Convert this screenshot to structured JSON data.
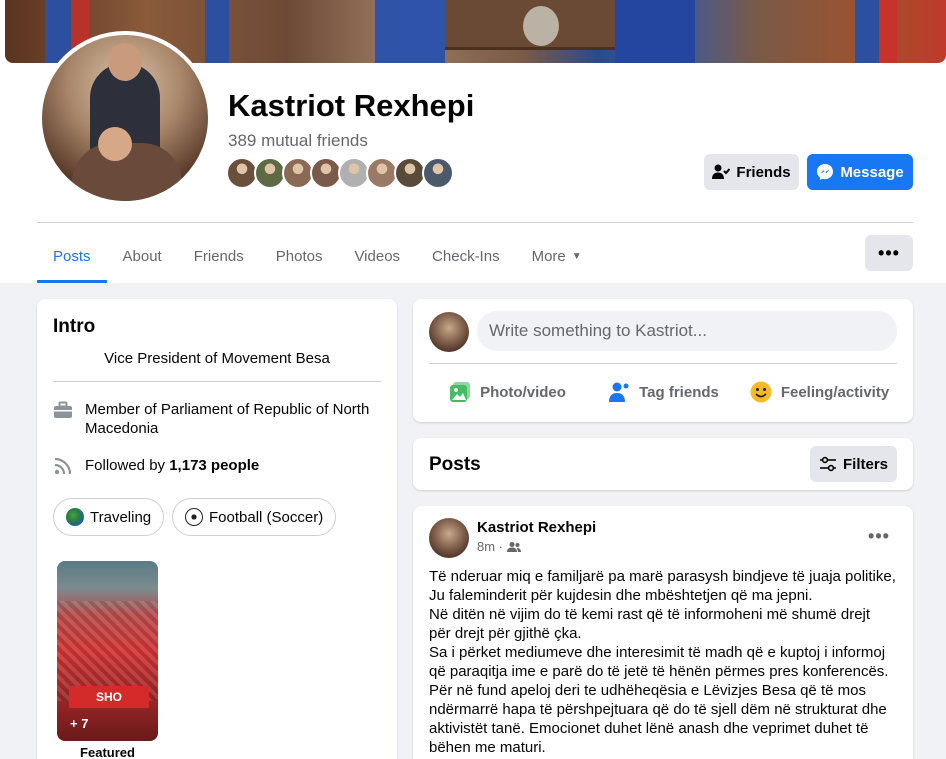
{
  "profile": {
    "name": "Kastriot Rexhepi",
    "mutual_friends": "389 mutual friends",
    "mutual_avatar_colors": [
      "#6a4f3c",
      "#5d6a43",
      "#8a6a55",
      "#7a5a4a",
      "#b0b0b0",
      "#9a7a64",
      "#5a4a3a",
      "#4a5a6a"
    ]
  },
  "actions": {
    "friends_label": "Friends",
    "message_label": "Message"
  },
  "tabs": [
    {
      "label": "Posts"
    },
    {
      "label": "About"
    },
    {
      "label": "Friends"
    },
    {
      "label": "Photos"
    },
    {
      "label": "Videos"
    },
    {
      "label": "Check-Ins"
    },
    {
      "label": "More"
    }
  ],
  "intro": {
    "title": "Intro",
    "bio": "Vice President of Movement Besa",
    "work": "Member of Parliament of Republic of North Macedonia",
    "followed_prefix": "Followed by ",
    "followed_count": "1,173 people",
    "hobbies": [
      {
        "label": "Traveling"
      },
      {
        "label": "Football (Soccer)"
      }
    ],
    "featured_count": "+ 7",
    "featured_label": "Featured",
    "featured_banner": "SHO"
  },
  "composer": {
    "placeholder": "Write something to Kastriot...",
    "photo_label": "Photo/video",
    "tag_label": "Tag friends",
    "feeling_label": "Feeling/activity"
  },
  "posts_section": {
    "title": "Posts",
    "filters_label": "Filters"
  },
  "post": {
    "author": "Kastriot Rexhepi",
    "time": "8m ·",
    "lines": [
      "Të nderuar miq e familjarë pa marë parasysh bindjeve të juaja politike,",
      "Ju faleminderit për kujdesin dhe mbështetjen që ma jepni.",
      "Në ditën në vijim do të kemi rast që të informoheni më shumë drejt",
      "për drejt për gjithë çka.",
      "Sa i përket mediumeve dhe interesimit të madh që e kuptoj i informoj",
      "që paraqitja ime e parë do të jetë të hënën përmes pres konferencës.",
      "Për në fund apeloj deri te udhëheqësia e Lëvizjes Besa që të mos",
      "ndërmarrë hapa të përshpejtuara që do të sjell dëm në strukturat dhe",
      "aktivistët tanë. Emocionet duhet lënë anash dhe veprimet duhet të",
      "bëhen me maturi."
    ]
  },
  "colors": {
    "accent": "#1877f2",
    "secondary_text": "#65676b",
    "button_gray": "#e4e6eb",
    "page_bg": "#f0f2f5"
  }
}
